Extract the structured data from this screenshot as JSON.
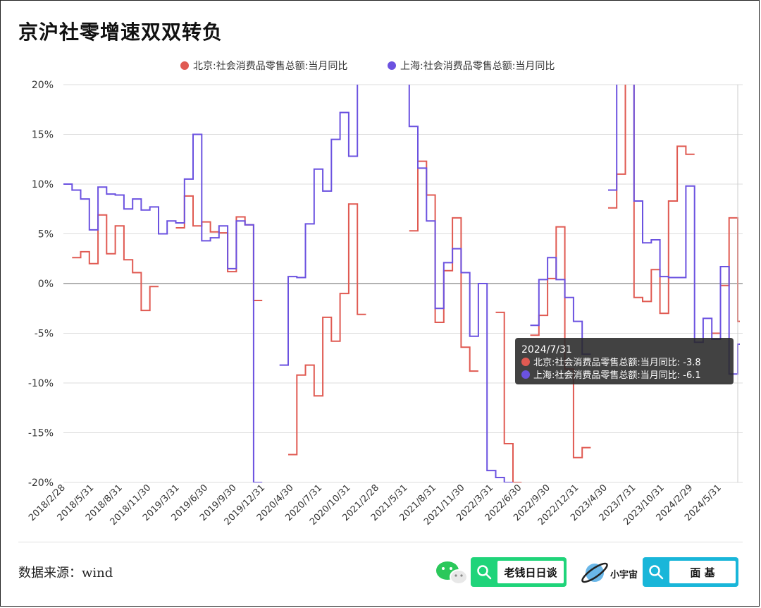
{
  "title": "京沪社零增速双双转负",
  "source": "数据来源：wind",
  "brand": {
    "badge1": "老钱日日谈",
    "badge2": "面 基",
    "planet": "小宇宙"
  },
  "tooltip": {
    "date": "2024/7/31",
    "line1": "北京:社会消费品零售总额:当月同比: -3.8",
    "line2": "上海:社会消费品零售总额:当月同比: -6.1"
  },
  "colors": {
    "beijing": "#e05a52",
    "shanghai": "#6b52e0",
    "grid": "#dddddd",
    "zero": "#666666"
  },
  "chart_data": {
    "type": "line",
    "step": true,
    "ylim": [
      -20,
      20
    ],
    "yticks": [
      -20,
      -15,
      -10,
      -5,
      0,
      5,
      10,
      15,
      20
    ],
    "ytick_labels": [
      "-20%",
      "-15%",
      "-10%",
      "-5%",
      "0%",
      "5%",
      "10%",
      "15%",
      "20%"
    ],
    "x_tick_labels": [
      "2018/2/28",
      "2018/5/31",
      "2018/8/31",
      "2018/11/30",
      "2019/3/31",
      "2019/6/30",
      "2019/9/30",
      "2019/12/31",
      "2020/4/30",
      "2020/7/31",
      "2020/10/31",
      "2021/2/28",
      "2021/5/31",
      "2021/8/31",
      "2021/11/30",
      "2022/3/31",
      "2022/6/30",
      "2022/9/30",
      "2022/12/31",
      "2023/4/30",
      "2023/7/31",
      "2023/10/31",
      "2024/2/29",
      "2024/5/31"
    ],
    "x_start": "2018/2",
    "x_end": "2024/7",
    "series": [
      {
        "name": "北京:社会消费品零售总额:当月同比",
        "color": "#e05a52",
        "values": [
          null,
          2.6,
          3.2,
          2.0,
          6.9,
          3.0,
          5.8,
          2.4,
          1.1,
          -2.7,
          -0.3,
          null,
          null,
          5.6,
          8.8,
          5.8,
          6.2,
          5.2,
          5.1,
          1.2,
          6.7,
          5.9,
          -1.7,
          null,
          null,
          null,
          -17.2,
          -9.2,
          -8.2,
          -11.3,
          -3.4,
          -5.8,
          -1.0,
          8.0,
          -3.1,
          null,
          null,
          null,
          null,
          null,
          5.3,
          12.3,
          8.9,
          -3.9,
          1.3,
          6.6,
          -6.4,
          -8.8,
          null,
          null,
          -2.9,
          -16.1,
          -20.0,
          null,
          -5.2,
          -3.2,
          0.5,
          5.7,
          -8.6,
          -17.5,
          -16.5,
          null,
          null,
          7.6,
          11.0,
          30.0,
          -1.4,
          -1.8,
          1.4,
          -3.0,
          8.3,
          13.8,
          13.0,
          null,
          null,
          -5.0,
          -0.2,
          6.6,
          -3.8
        ]
      },
      {
        "name": "上海:社会消费品零售总额:当月同比",
        "color": "#6b52e0",
        "values": [
          10.0,
          9.4,
          8.5,
          5.4,
          9.7,
          9.0,
          8.9,
          7.5,
          8.5,
          7.4,
          7.7,
          5.0,
          6.3,
          6.1,
          10.5,
          15.0,
          4.3,
          4.6,
          5.8,
          1.5,
          6.3,
          5.9,
          -20.0,
          null,
          null,
          -8.2,
          0.7,
          0.6,
          6.0,
          11.5,
          9.3,
          14.5,
          17.2,
          12.8,
          22.0,
          null,
          null,
          null,
          null,
          26.0,
          15.8,
          11.6,
          6.3,
          -2.5,
          2.1,
          3.5,
          1.1,
          -5.3,
          0.0,
          -18.8,
          -19.5,
          -20.0,
          null,
          null,
          -4.2,
          0.4,
          2.6,
          0.4,
          -1.4,
          -3.8,
          -7.1,
          null,
          null,
          9.4,
          21.0,
          42.0,
          8.3,
          4.1,
          4.4,
          0.7,
          0.6,
          0.6,
          9.8,
          -5.9,
          -3.5,
          -5.6,
          1.7,
          -9.1,
          -6.1
        ]
      }
    ]
  }
}
